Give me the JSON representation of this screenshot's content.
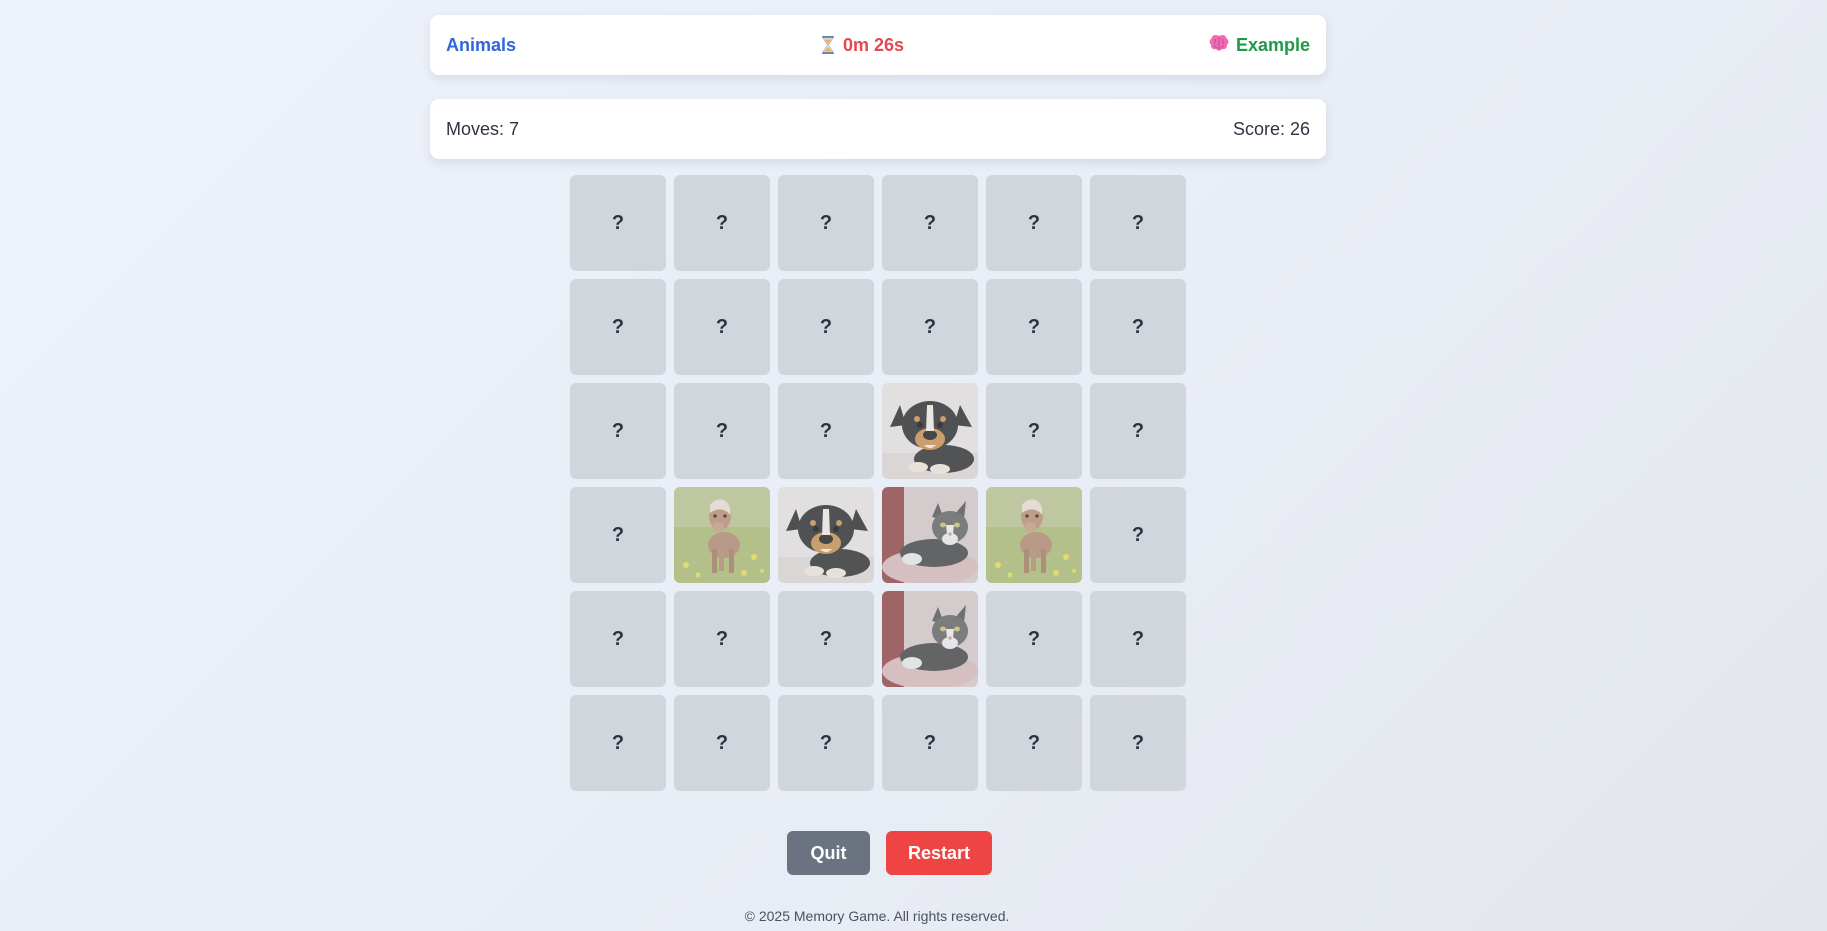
{
  "header": {
    "category": "Animals",
    "timer": "0m 26s",
    "player": "Example",
    "icons": {
      "timer": "hourglass-icon",
      "player": "brain-icon"
    }
  },
  "stats": {
    "moves": "Moves: 7",
    "score": "Score: 26"
  },
  "board": {
    "rows": 6,
    "cols": 6,
    "hidden_symbol": "?",
    "cards": [
      "?",
      "?",
      "?",
      "?",
      "?",
      "?",
      "?",
      "?",
      "?",
      "?",
      "?",
      "?",
      "?",
      "?",
      "?",
      "puppy",
      "?",
      "?",
      "?",
      "pony",
      "puppy",
      "cat",
      "pony",
      "?",
      "?",
      "?",
      "?",
      "cat",
      "?",
      "?",
      "?",
      "?",
      "?",
      "?",
      "?",
      "?"
    ]
  },
  "controls": {
    "quit_label": "Quit",
    "restart_label": "Restart"
  },
  "footer": {
    "text": "© 2025 Memory Game. All rights reserved."
  },
  "colors": {
    "category": "#2f67d8",
    "timer": "#e5484d",
    "player": "#1f9a48",
    "card_hidden": "#d1d5dc",
    "quit": "#6b7280",
    "restart": "#ef4444"
  }
}
